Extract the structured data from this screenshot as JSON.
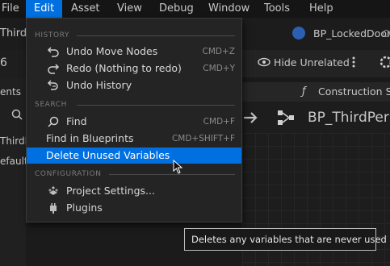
{
  "menubar": {
    "items": [
      {
        "label": "File"
      },
      {
        "label": "Edit"
      },
      {
        "label": "Asset"
      },
      {
        "label": "View"
      },
      {
        "label": "Debug"
      },
      {
        "label": "Window"
      },
      {
        "label": "Tools"
      },
      {
        "label": "Help"
      }
    ]
  },
  "background": {
    "left_tab": "ThirdPers",
    "top_tab": "BP_LockedDoor",
    "hide_unrelated": "Hide Unrelated",
    "left_panel_label": "ents",
    "construction_tab": "Construction Sc",
    "blueprint_name": "BP_ThirdPer",
    "left_graph_label": "ThirdPers",
    "default_label": "efaultS"
  },
  "edit_menu": {
    "history": {
      "header": "HISTORY",
      "items": [
        {
          "label": "Undo Move Nodes",
          "shortcut": "CMD+Z",
          "icon": "undo-icon"
        },
        {
          "label": "Redo (Nothing to redo)",
          "shortcut": "CMD+Y",
          "icon": "redo-icon"
        },
        {
          "label": "Undo History",
          "shortcut": "",
          "icon": "history-icon"
        }
      ]
    },
    "search": {
      "header": "SEARCH",
      "items": [
        {
          "label": "Find",
          "shortcut": "CMD+F",
          "icon": "find-icon"
        },
        {
          "label": "Find in Blueprints",
          "shortcut": "CMD+SHIFT+F"
        },
        {
          "label": "Delete Unused Variables",
          "shortcut": ""
        }
      ]
    },
    "configuration": {
      "header": "CONFIGURATION",
      "items": [
        {
          "label": "Project Settings...",
          "icon": "settings-icon"
        },
        {
          "label": "Plugins",
          "icon": "plugins-icon"
        }
      ]
    }
  },
  "tooltip": {
    "text": "Deletes any variables that are never used"
  },
  "colors": {
    "accent": "#0070e0",
    "menu_bg": "#242424",
    "window_bg": "#1a1a1a"
  }
}
